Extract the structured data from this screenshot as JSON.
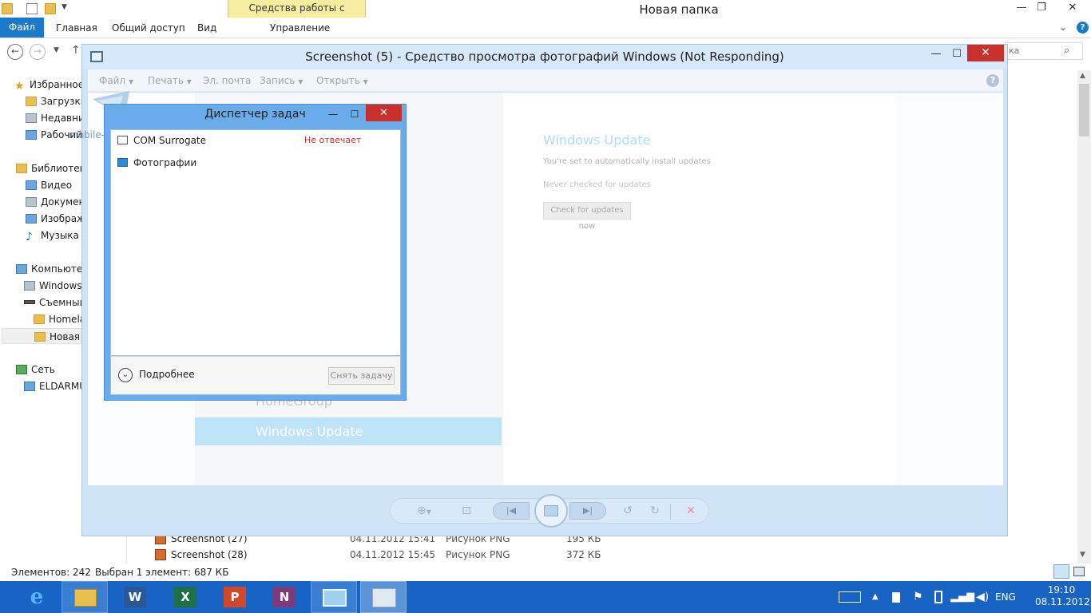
{
  "explorer": {
    "window_title": "Новая папка",
    "tools_context_tab": "Средства работы с рисунками",
    "tabs": {
      "file": "Файл",
      "home": "Главная",
      "share": "Общий доступ",
      "view": "Вид",
      "manage": "Управление"
    },
    "search_placeholder": "ка",
    "nav": {
      "favorites": "Избранное",
      "downloads": "Загрузки",
      "recent": "Недавние",
      "desktop": "Рабочий",
      "libraries": "Библиотеки",
      "video": "Видео",
      "documents": "Докумен",
      "images": "Изображ",
      "music": "Музыка",
      "computer": "Компьютер",
      "windows": "Windows",
      "removable": "Съемный",
      "homela": "Homela",
      "new_folder": "Новая п",
      "network": "Сеть",
      "eldarmu": "ELDARMU"
    },
    "files": [
      {
        "name": "Screenshot (27)",
        "date": "04.11.2012 15:41",
        "type": "Рисунок PNG",
        "size": "195 КБ"
      },
      {
        "name": "Screenshot (28)",
        "date": "04.11.2012 15:45",
        "type": "Рисунок PNG",
        "size": "372 КБ"
      }
    ],
    "status_count": "Элементов: 242",
    "status_selected": "Выбран 1 элемент: 687 КБ"
  },
  "viewer": {
    "title": "Screenshot (5) - Средство просмотра фотографий Windows (Not Responding)",
    "menu": {
      "file": "Файл",
      "print": "Печать",
      "email": "Эл. почта",
      "burn": "Запись",
      "open": "Открыть"
    },
    "help_label": "?",
    "photo": {
      "homegroup": "HomeGroup",
      "windows_update_nav": "Windows Update",
      "wu_title": "Windows Update",
      "wu_sub": "You're set to automatically install updates",
      "wu_never": "Never checked for updates",
      "wu_button": "Check for updates now"
    }
  },
  "taskmgr": {
    "title": "Диспетчер задач",
    "processes": [
      {
        "name": "COM Surrogate",
        "status": "Не отвечает"
      },
      {
        "name": "Фотографии",
        "status": ""
      }
    ],
    "more_details": "Подробнее",
    "end_task": "Снять задачу"
  },
  "watermark": {
    "text": "mobile-review.com"
  },
  "taskbar": {
    "apps": [
      {
        "name": "internet-explorer",
        "glyph": "e"
      },
      {
        "name": "file-explorer",
        "glyph": ""
      },
      {
        "name": "word",
        "glyph": "W"
      },
      {
        "name": "excel",
        "glyph": "X"
      },
      {
        "name": "powerpoint",
        "glyph": "P"
      },
      {
        "name": "onenote",
        "glyph": "N"
      },
      {
        "name": "photo-viewer",
        "glyph": ""
      },
      {
        "name": "task-manager",
        "glyph": ""
      }
    ],
    "lang": "ENG",
    "time": "19:10",
    "date": "08.11.2012"
  },
  "colors": {
    "taskbar": "#1764c4",
    "file_tab": "#1979ca",
    "close_red": "#c7302b",
    "taskmgr_frame": "#6aabea",
    "not_responding_status": "#c8312b"
  }
}
